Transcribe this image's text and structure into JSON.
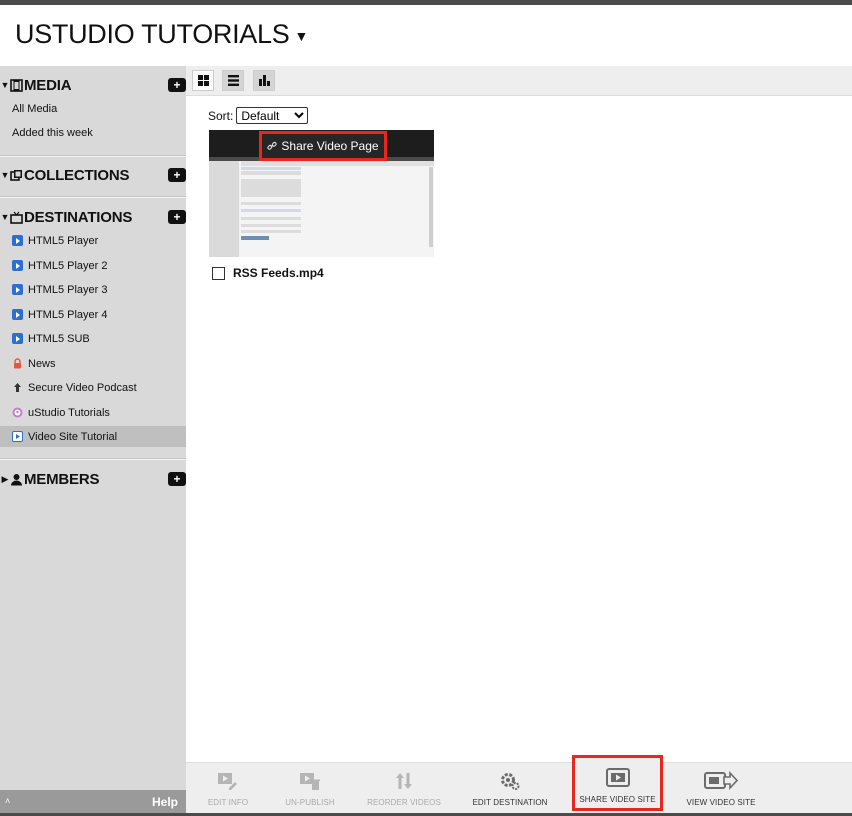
{
  "header": {
    "title": "USTUDIO TUTORIALS"
  },
  "sidebar": {
    "media": {
      "label": "MEDIA",
      "items": [
        "All Media",
        "Added this week"
      ]
    },
    "collections": {
      "label": "COLLECTIONS"
    },
    "destinations": {
      "label": "DESTINATIONS",
      "items": [
        {
          "label": "HTML5 Player",
          "icon": "blue-play-icon"
        },
        {
          "label": "HTML5 Player 2",
          "icon": "blue-play-icon"
        },
        {
          "label": "HTML5 Player 3",
          "icon": "blue-play-icon"
        },
        {
          "label": "HTML5 Player 4",
          "icon": "blue-play-icon"
        },
        {
          "label": "HTML5 SUB",
          "icon": "blue-play-icon"
        },
        {
          "label": "News",
          "icon": "lock-icon"
        },
        {
          "label": "Secure Video Podcast",
          "icon": "upload-icon"
        },
        {
          "label": "uStudio Tutorials",
          "icon": "podcast-icon"
        },
        {
          "label": "Video Site Tutorial",
          "icon": "video-site-icon",
          "selected": true
        }
      ]
    },
    "members": {
      "label": "MEMBERS"
    },
    "bottom": {
      "up": "˄",
      "help": "Help"
    }
  },
  "main": {
    "sort_label": "Sort:",
    "sort_value": "Default",
    "share_button": "Share Video Page",
    "file_name": "RSS Feeds.mp4"
  },
  "toolbar": {
    "edit_info": "EDIT INFO",
    "unpublish": "UN-PUBLISH",
    "reorder": "REORDER VIDEOS",
    "edit_destination": "EDIT DESTINATION",
    "share_video_site": "SHARE VIDEO SITE",
    "view_video_site": "VIEW VIDEO SITE"
  },
  "colors": {
    "highlight": "#e8281e",
    "sidebar": "#d9d9d9",
    "selected": "#bfbfbf",
    "accent": "#2b6fd1"
  }
}
